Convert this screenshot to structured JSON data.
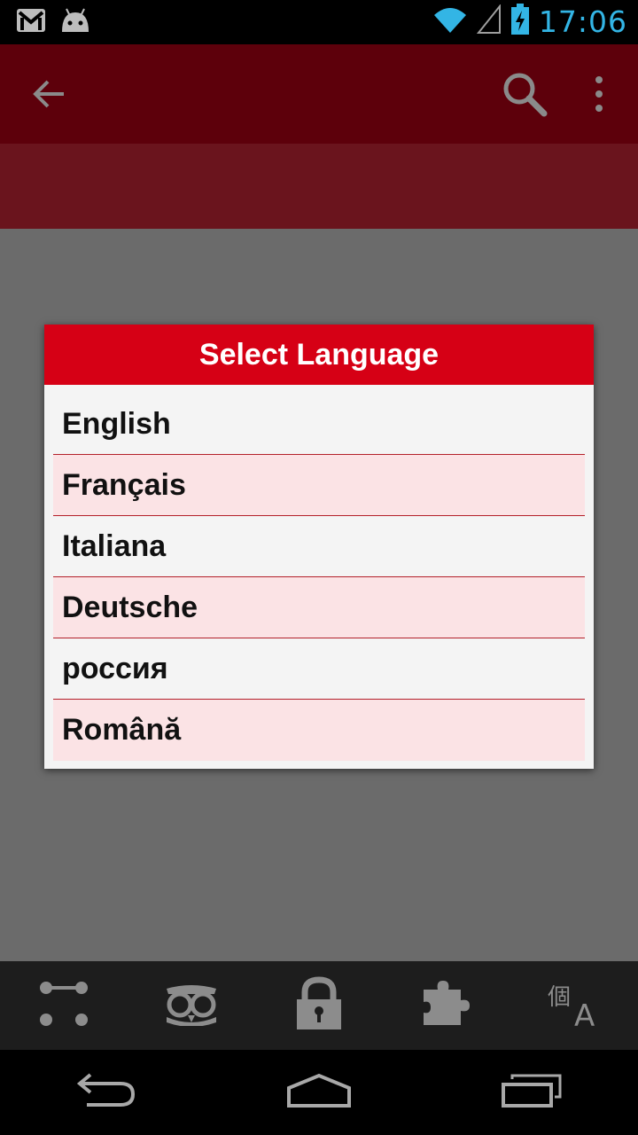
{
  "status_bar": {
    "time": "17:06",
    "icons": [
      "gmail-icon",
      "android-icon",
      "wifi-icon",
      "signal-icon",
      "battery-charging-icon"
    ]
  },
  "app_bar": {
    "icons": [
      "back-arrow-icon",
      "search-icon",
      "overflow-menu-icon"
    ]
  },
  "dialog": {
    "title": "Select Language",
    "languages": [
      "English",
      "Français",
      "Italiana",
      "Deutsche",
      "россия",
      "Română"
    ]
  },
  "tab_bar": {
    "icons": [
      "pattern-lock-icon",
      "owl-icon",
      "padlock-icon",
      "puzzle-piece-icon",
      "translate-icon"
    ],
    "translate_glyph": "個",
    "translate_letter": "A"
  },
  "nav_bar": {
    "icons": [
      "back-icon",
      "home-icon",
      "recent-apps-icon"
    ]
  },
  "colors": {
    "app_bar": "#5d000b",
    "sub_bar": "#6a141d",
    "dialog_title": "#d60015",
    "clock": "#33b5e5",
    "row_alt": "#fbe3e5"
  }
}
